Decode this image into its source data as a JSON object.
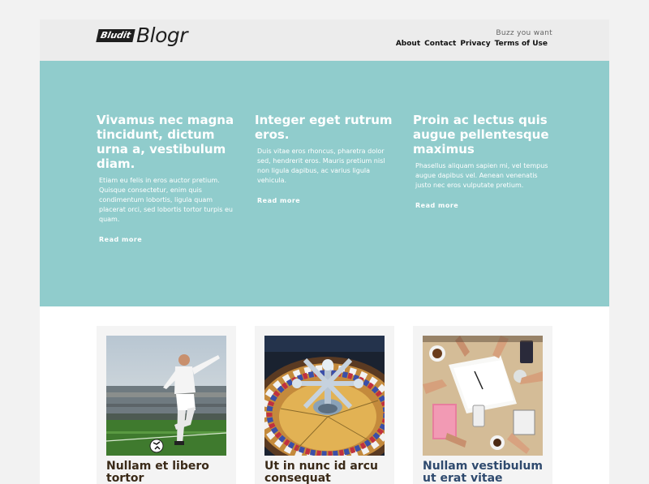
{
  "header": {
    "logo_badge": "Bludit",
    "logo_text": "Blogr",
    "tagline": "Buzz you want",
    "nav": [
      "About",
      "Contact",
      "Privacy",
      "Terms of Use"
    ]
  },
  "hero": {
    "columns": [
      {
        "title": "Vivamus nec magna tincidunt, dictum urna a, vestibulum diam.",
        "text": "Etiam eu felis in eros auctor pretium. Quisque consectetur, enim quis condimentum lobortis, ligula quam placerat orci, sed lobortis tortor turpis eu quam.",
        "link": "Read more"
      },
      {
        "title": "Integer eget rutrum eros.",
        "text": "Duis vitae eros rhoncus, pharetra dolor sed, hendrerit eros. Mauris pretium nisl non ligula dapibus, ac varius ligula vehicula.",
        "link": "Read more"
      },
      {
        "title": "Proin ac lectus quis augue pellentesque maximus",
        "text": "Phasellus aliquam sapien mi, vel tempus augue dapibus vel. Aenean venenatis justo nec eros vulputate pretium.",
        "link": "Read more"
      }
    ],
    "color": "#90cccc"
  },
  "cards": [
    {
      "title": "Nullam et libero tortor",
      "image": "soccer-player-photo"
    },
    {
      "title": "Ut in nunc id arcu consequat",
      "image": "roulette-wheel-photo"
    },
    {
      "title": "Nullam vestibulum ut erat vitae",
      "image": "desk-meeting-photo"
    }
  ]
}
